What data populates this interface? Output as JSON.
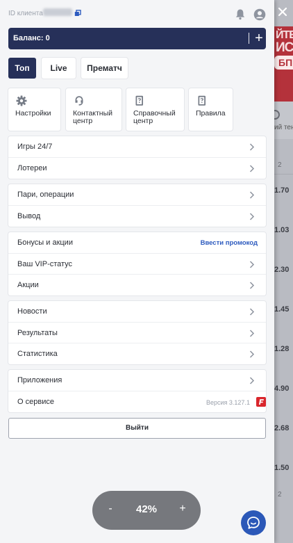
{
  "client": {
    "id_label": "ID клиента"
  },
  "balance": {
    "text": "Баланс: 0",
    "add_label": "+"
  },
  "tabs": [
    {
      "label": "Топ",
      "active": true
    },
    {
      "label": "Live",
      "active": false
    },
    {
      "label": "Прематч",
      "active": false
    }
  ],
  "cards": [
    {
      "label": "Настройки",
      "icon": "gear-icon"
    },
    {
      "label": "Контактный\nцентр",
      "icon": "headset-icon"
    },
    {
      "label": "Справочный\nцентр",
      "icon": "help-doc-icon"
    },
    {
      "label": "Правила",
      "icon": "rules-doc-icon"
    }
  ],
  "menu": {
    "games": "Игры 24/7",
    "lotteries": "Лотереи",
    "bets_operations": "Пари, операции",
    "withdraw": "Вывод",
    "bonuses": "Бонусы и акции",
    "promo_link": "Ввести промокод",
    "vip": "Ваш VIP-статус",
    "promotions": "Акции",
    "news": "Новости",
    "results": "Результаты",
    "statistics": "Статистика",
    "apps": "Приложения",
    "about": "О сервисе",
    "version": "Версия 3.127.1"
  },
  "logout_label": "Выйти",
  "zoom": {
    "minus": "-",
    "value": "42%",
    "plus": "+"
  },
  "background": {
    "banner_line1": "ЙТЕ",
    "banner_line2": "ИС",
    "banner_badge": "БП",
    "header_text": "ий тени",
    "values": [
      "2",
      "1.70",
      "1.03",
      "2.30",
      "1.45",
      "1.28",
      "4.90",
      "2.68",
      "1.50",
      "2"
    ]
  },
  "colors": {
    "primary": "#263059",
    "link": "#2d5bbf",
    "chat": "#2b58b8",
    "brand_red": "#d9262c"
  }
}
